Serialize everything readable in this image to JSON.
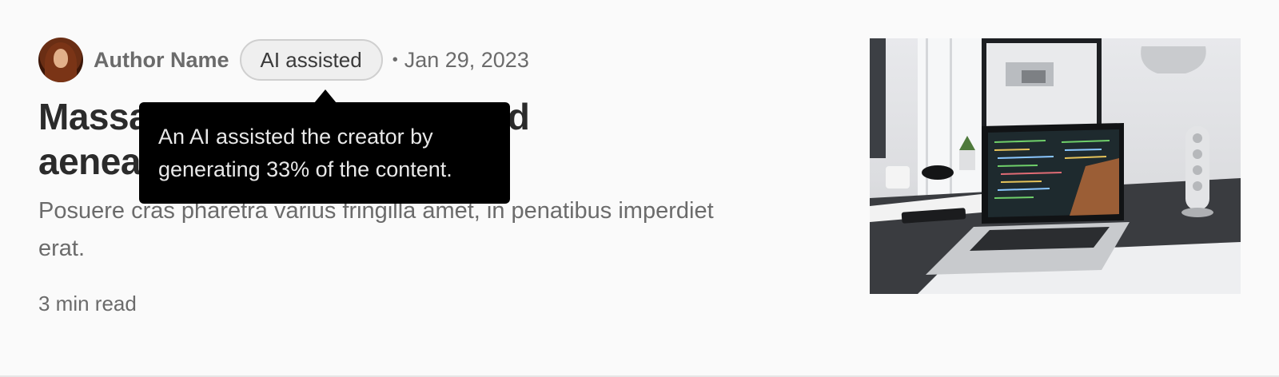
{
  "author": {
    "name": "Author Name",
    "avatar_icon": "avatar-portrait"
  },
  "badge": {
    "label": "AI assisted"
  },
  "separator": "•",
  "date": "Jan 29, 2023",
  "title": "Massa tincidunt dui ut ornare lectus sit amet est placerat in egestas erat. Massa ultricies sed aenean etiam erat velit scelerisque",
  "title_visible": "Massa tincidunt ultricies sed aenean etiam scelerisque",
  "subtitle": "Posuere cras pharetra varius fringilla amet, in penatibus imperdiet erat.",
  "read_time": "3 min read",
  "tooltip": {
    "text": "An AI assisted the creator by generating 33% of the content."
  },
  "thumbnail": {
    "icon": "laptop-desk-photo"
  },
  "colors": {
    "background": "#fafafa",
    "title": "#2b2b2b",
    "muted": "#6b6b6b",
    "tooltip_bg": "#000000",
    "badge_bg": "#efefef",
    "badge_border": "#cfcfcf"
  }
}
